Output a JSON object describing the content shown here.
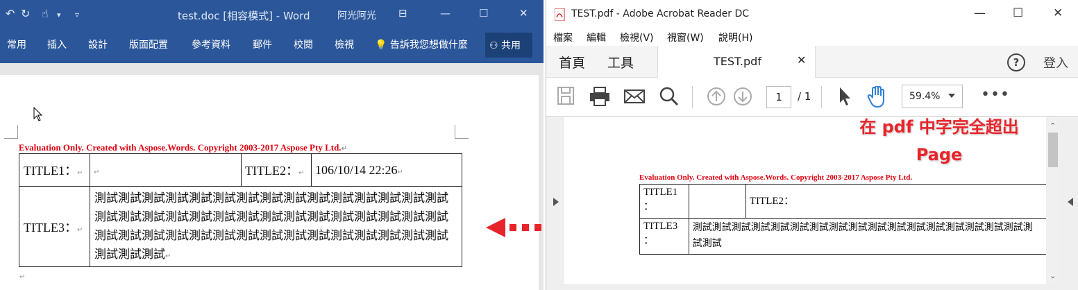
{
  "word": {
    "title": "test.doc [相容模式] - Word",
    "user": "阿光阿光",
    "tabs": [
      "常用",
      "插入",
      "設計",
      "版面配置",
      "參考資料",
      "郵件",
      "校閱",
      "檢視"
    ],
    "tell_me": "告訴我您想做什麼",
    "share": "共用",
    "eval_text": "Evaluation Only. Created with Aspose.Words. Copyright 2003-2017 Aspose Pty Ltd.",
    "table": {
      "title1": "TITLE1：",
      "title2": "TITLE2：",
      "date": "106/10/14 22:26",
      "title3": "TITLE3：",
      "body": "測試測試測試測試測試測試測試測試測試測試測試測試測試測試測試測試測試測試測試測試測試測試測試測試測試測試測試測試測試測試測試測試測試測試測試測試測試測試測試測試測試測試測試測試測試測試測試測試"
    }
  },
  "pdf": {
    "title": "TEST.pdf - Adobe Acrobat Reader DC",
    "menu": [
      "檔案",
      "編輯",
      "檢視(V)",
      "視窗(W)",
      "說明(H)"
    ],
    "home": "首頁",
    "tools": "工具",
    "tab_label": "TEST.pdf",
    "help": "?",
    "login": "登入",
    "page_current": "1",
    "page_total": "/ 1",
    "zoom": "59.4%",
    "note_line1": "在 pdf 中字完全超出",
    "note_line2": "Page",
    "eval_text": "Evaluation Only. Created with Aspose.Words. Copyright 2003-2017 Aspose Pty Ltd.",
    "table": {
      "title1": "TITLE1",
      "title2": "TITLE2：",
      "title3": "TITLE3",
      "colon": "：",
      "body1": "測試測試測試測試測試測試測試測試測試測試測試測試測試測試測試測試測試測",
      "body2": "試測試"
    }
  },
  "colors": {
    "word_blue": "#2b579a",
    "eval_red": "#e0000f",
    "arrow_red": "#e8242b"
  }
}
